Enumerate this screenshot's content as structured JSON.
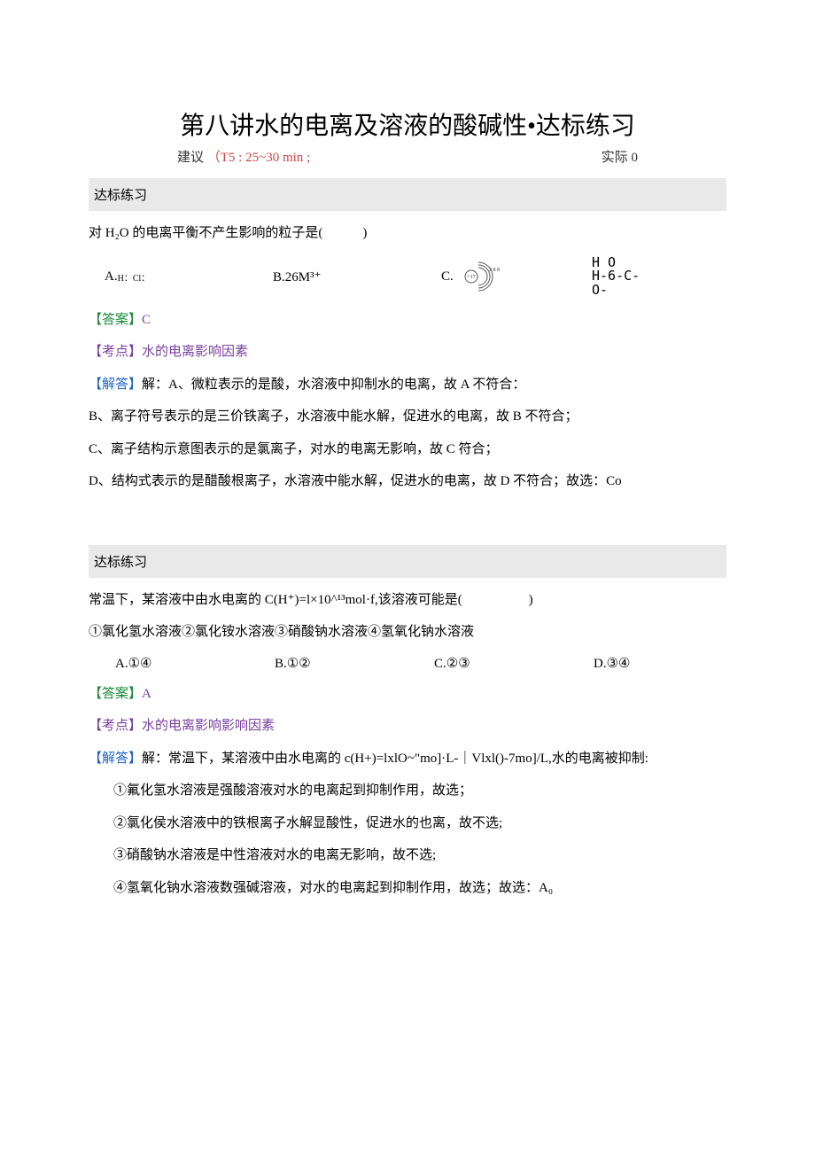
{
  "header": {
    "title": "第八讲水的电离及溶液的酸碱性•达标练习",
    "suggestion_label": "建议",
    "suggestion_value": "（T5 : 25~30 min ;",
    "actual_label": "实际 0"
  },
  "q1": {
    "section_label": "达标练习",
    "stem": "对 H₂O 的电离平衡不产生影响的粒子是(　　　)",
    "optA_prefix": "A.",
    "optA_hcl": "H：Cl：",
    "optB": "B.26M³⁺",
    "optC": "C.",
    "atom_center": "+17",
    "atom_shells": "2 8 8",
    "optD_line1": "H O",
    "optD_line2": "H-6-C-",
    "optD_line3": "O-",
    "answer_label": "【答案】",
    "answer_value": "C",
    "topic_label": "【考点】",
    "topic_value": "水的电离影响因素",
    "explain_label": "【解答】",
    "explainA": "解：A、微粒表示的是酸，水溶液中抑制水的电离，故 A 不符合：",
    "explainB": "B、离子符号表示的是三价铁离子，水溶液中能水解，促进水的电离，故 B 不符合；",
    "explainC": "C、离子结构示意图表示的是氯离子，对水的电离无影响，故 C 符合；",
    "explainD": "D、结构式表示的是醋酸根离子，水溶液中能水解，促进水的电离，故 D 不符合；故选：Co"
  },
  "q2": {
    "section_label": "达标练习",
    "stem": "常温下，某溶液中由水电离的 C(H⁺)=l×10^¹³mol·f,该溶液可能是(　　　　　)",
    "stem2": "①氯化氢水溶液②氯化铵水溶液③硝酸钠水溶液④氢氧化钠水溶液",
    "optA": "A.①④",
    "optB": "B.①②",
    "optC": "C.②③",
    "optD": "D.③④",
    "answer_label": "【答案】",
    "answer_value": "A",
    "topic_label": "【考点】",
    "topic_value": "水的电离影响影响因素",
    "explain_label": "【解答】",
    "explain_head": "解：常温下，某溶液中由水电离的 c(H+)=lxlO~\"mo]·L-｜Vlxl()-7mo]/L,水的电离被抑制:",
    "explain1": "①氟化氢水溶液是强酸溶液对水的电离起到抑制作用，故选；",
    "explain2": "②氯化侯水溶液中的铁根离子水解显酸性，促进水的也离，故不选;",
    "explain3": "③硝酸钠水溶液是中性溶液对水的电离无影响，故不选;",
    "explain4": "④氢氧化钠水溶液数强碱溶液，对水的电离起到抑制作用，故选；故选：A₀"
  }
}
